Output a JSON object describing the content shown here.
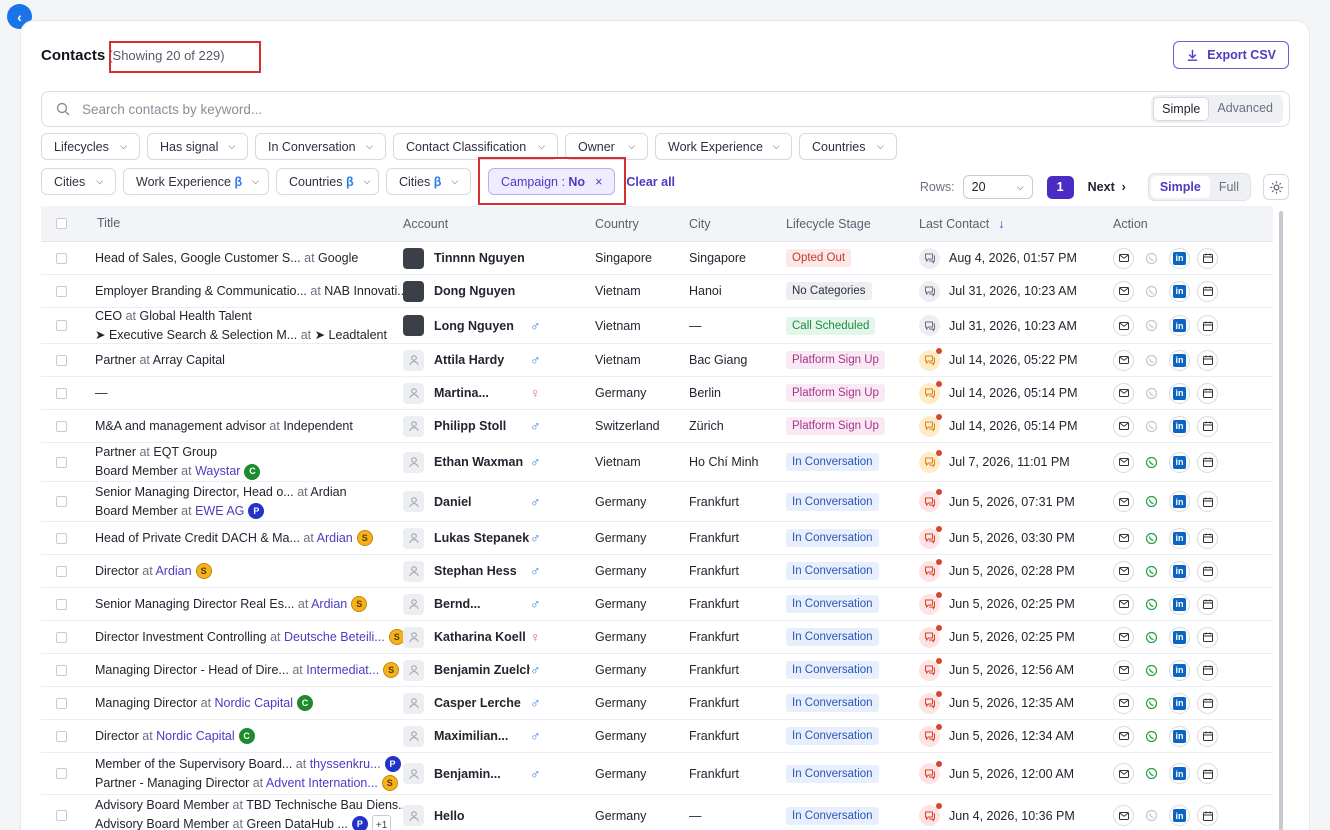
{
  "header": {
    "title": "Contacts",
    "count": "(Showing 20 of 229)",
    "export_label": "Export CSV"
  },
  "search": {
    "placeholder": "Search contacts by keyword...",
    "mode_simple": "Simple",
    "mode_advanced": "Advanced"
  },
  "filters_row1": [
    "Lifecycles",
    "Has signal",
    "In Conversation",
    "Contact Classification",
    "Owner",
    "Work Experience",
    "Countries"
  ],
  "filters_row2": [
    {
      "label": "Cities",
      "beta": ""
    },
    {
      "label": "Work Experience",
      "beta": "β"
    },
    {
      "label": "Countries",
      "beta": "β"
    },
    {
      "label": "Cities",
      "beta": "β"
    }
  ],
  "active_filter": {
    "prefix": "Campaign : ",
    "value": "No",
    "remove": "×"
  },
  "clear_all": "Clear all",
  "pagination": {
    "rows_label": "Rows:",
    "rows_value": "20",
    "page": "1",
    "next": "Next",
    "view_simple": "Simple",
    "view_full": "Full"
  },
  "columns": {
    "title": "Title",
    "account": "Account",
    "country": "Country",
    "city": "City",
    "lifecycle": "Lifecycle Stage",
    "last_contact": "Last Contact",
    "action": "Action"
  },
  "colors": {
    "accent": "#4a2bc4",
    "link": "#4b3cc2",
    "highlight_box": "#d62f2f"
  },
  "rows": [
    {
      "lines": [
        {
          "t": "Head of Sales, Google Customer S...",
          "at": "Google",
          "link": false,
          "tag": ""
        }
      ],
      "name": "Tinnnn Nguyen",
      "avatar": "photo",
      "gender": "",
      "country": "Singapore",
      "city": "Singapore",
      "stage": "Opted Out",
      "stage_kind": "out",
      "msg": "grey",
      "dot": false,
      "date": "Aug 4, 2026, 01:57 PM",
      "wa": false
    },
    {
      "lines": [
        {
          "t": "Employer Branding & Communicatio...",
          "at": "NAB Innovati...",
          "link": false,
          "tag": ""
        }
      ],
      "name": "Dong Nguyen",
      "avatar": "photo",
      "gender": "",
      "country": "Vietnam",
      "city": "Hanoi",
      "stage": "No Categories",
      "stage_kind": "nocat",
      "msg": "grey",
      "dot": false,
      "date": "Jul 31, 2026, 10:23 AM",
      "wa": false
    },
    {
      "lines": [
        {
          "t": "CEO",
          "at": "Global Health Talent",
          "link": false,
          "tag": ""
        },
        {
          "t": "➤ Executive Search & Selection M...",
          "at": "➤ Leadtalent",
          "link": false,
          "tag": ""
        }
      ],
      "name": "Long Nguyen",
      "avatar": "photo",
      "gender": "male",
      "country": "Vietnam",
      "city": "—",
      "stage": "Call Scheduled",
      "stage_kind": "call",
      "msg": "grey",
      "dot": false,
      "date": "Jul 31, 2026, 10:23 AM",
      "wa": false
    },
    {
      "lines": [
        {
          "t": "Partner",
          "at": "Array Capital",
          "link": false,
          "tag": ""
        }
      ],
      "name": "Attila Hardy",
      "avatar": "ph",
      "gender": "male",
      "country": "Vietnam",
      "city": "Bac Giang",
      "stage": "Platform Sign Up",
      "stage_kind": "sign",
      "msg": "orange",
      "dot": true,
      "date": "Jul 14, 2026, 05:22 PM",
      "wa": false
    },
    {
      "lines": [
        {
          "t": "—",
          "at": "",
          "link": false,
          "tag": ""
        }
      ],
      "name": "Martina...",
      "avatar": "ph",
      "gender": "female",
      "country": "Germany",
      "city": "Berlin",
      "stage": "Platform Sign Up",
      "stage_kind": "sign",
      "msg": "orange",
      "dot": true,
      "date": "Jul 14, 2026, 05:14 PM",
      "wa": false
    },
    {
      "lines": [
        {
          "t": "M&A and management advisor",
          "at": "Independent",
          "link": false,
          "tag": ""
        }
      ],
      "name": "Philipp Stoll",
      "avatar": "ph",
      "gender": "male",
      "country": "Switzerland",
      "city": "Zürich",
      "stage": "Platform Sign Up",
      "stage_kind": "sign",
      "msg": "orange",
      "dot": true,
      "date": "Jul 14, 2026, 05:14 PM",
      "wa": false
    },
    {
      "lines": [
        {
          "t": "Partner",
          "at": "EQT Group",
          "link": false,
          "tag": ""
        },
        {
          "t": "Board Member",
          "at": "Waystar",
          "link": true,
          "tag": "C"
        }
      ],
      "name": "Ethan Waxman",
      "avatar": "ph",
      "gender": "male",
      "country": "Vietnam",
      "city": "Ho Chí Minh",
      "stage": "In Conversation",
      "stage_kind": "conv",
      "msg": "orange",
      "dot": true,
      "date": "Jul 7, 2026, 11:01 PM",
      "wa": true
    },
    {
      "lines": [
        {
          "t": "Senior Managing Director, Head o...",
          "at": "Ardian",
          "link": false,
          "tag": ""
        },
        {
          "t": "Board Member",
          "at": "EWE AG",
          "link": true,
          "tag": "P"
        }
      ],
      "name": "Daniel",
      "avatar": "ph",
      "gender": "male",
      "country": "Germany",
      "city": "Frankfurt",
      "stage": "In Conversation",
      "stage_kind": "conv",
      "msg": "red",
      "dot": true,
      "date": "Jun 5, 2026, 07:31 PM",
      "wa": true
    },
    {
      "lines": [
        {
          "t": "Head of Private Credit DACH & Ma...",
          "at": "Ardian",
          "link": true,
          "tag": "S"
        }
      ],
      "name": "Lukas Stepanek",
      "avatar": "ph",
      "gender": "male",
      "country": "Germany",
      "city": "Frankfurt",
      "stage": "In Conversation",
      "stage_kind": "conv",
      "msg": "red",
      "dot": true,
      "date": "Jun 5, 2026, 03:30 PM",
      "wa": true
    },
    {
      "lines": [
        {
          "t": "Director",
          "at": "Ardian",
          "link": true,
          "tag": "S"
        }
      ],
      "name": "Stephan Hess",
      "avatar": "ph",
      "gender": "male",
      "country": "Germany",
      "city": "Frankfurt",
      "stage": "In Conversation",
      "stage_kind": "conv",
      "msg": "red",
      "dot": true,
      "date": "Jun 5, 2026, 02:28 PM",
      "wa": true
    },
    {
      "lines": [
        {
          "t": "Senior Managing Director Real Es...",
          "at": "Ardian",
          "link": true,
          "tag": "S"
        }
      ],
      "name": "Bernd...",
      "avatar": "ph",
      "gender": "male",
      "country": "Germany",
      "city": "Frankfurt",
      "stage": "In Conversation",
      "stage_kind": "conv",
      "msg": "red",
      "dot": true,
      "date": "Jun 5, 2026, 02:25 PM",
      "wa": true
    },
    {
      "lines": [
        {
          "t": "Director Investment Controlling",
          "at": "Deutsche Beteili...",
          "link": true,
          "tag": "S"
        }
      ],
      "name": "Katharina Koell",
      "avatar": "ph",
      "gender": "female",
      "country": "Germany",
      "city": "Frankfurt",
      "stage": "In Conversation",
      "stage_kind": "conv",
      "msg": "red",
      "dot": true,
      "date": "Jun 5, 2026, 02:25 PM",
      "wa": true
    },
    {
      "lines": [
        {
          "t": "Managing Director - Head of Dire...",
          "at": "Intermediat...",
          "link": true,
          "tag": "S"
        }
      ],
      "name": "Benjamin Zuelch",
      "avatar": "ph",
      "gender": "male",
      "country": "Germany",
      "city": "Frankfurt",
      "stage": "In Conversation",
      "stage_kind": "conv",
      "msg": "red",
      "dot": true,
      "date": "Jun 5, 2026, 12:56 AM",
      "wa": true
    },
    {
      "lines": [
        {
          "t": "Managing Director",
          "at": "Nordic Capital",
          "link": true,
          "tag": "C"
        }
      ],
      "name": "Casper Lerche",
      "avatar": "ph",
      "gender": "male",
      "country": "Germany",
      "city": "Frankfurt",
      "stage": "In Conversation",
      "stage_kind": "conv",
      "msg": "red",
      "dot": true,
      "date": "Jun 5, 2026, 12:35 AM",
      "wa": true
    },
    {
      "lines": [
        {
          "t": "Director",
          "at": "Nordic Capital",
          "link": true,
          "tag": "C"
        }
      ],
      "name": "Maximilian...",
      "avatar": "ph",
      "gender": "male",
      "country": "Germany",
      "city": "Frankfurt",
      "stage": "In Conversation",
      "stage_kind": "conv",
      "msg": "red",
      "dot": true,
      "date": "Jun 5, 2026, 12:34 AM",
      "wa": true
    },
    {
      "lines": [
        {
          "t": "Member of the Supervisory Board...",
          "at": "thyssenkru...",
          "link": true,
          "tag": "P"
        },
        {
          "t": "Partner - Managing Director",
          "at": "Advent Internation...",
          "link": true,
          "tag": "S"
        }
      ],
      "name": "Benjamin...",
      "avatar": "ph",
      "gender": "male",
      "country": "Germany",
      "city": "Frankfurt",
      "stage": "In Conversation",
      "stage_kind": "conv",
      "msg": "red",
      "dot": true,
      "date": "Jun 5, 2026, 12:00 AM",
      "wa": true
    },
    {
      "lines": [
        {
          "t": "Advisory Board Member",
          "at": "TBD Technische Bau Diens...",
          "link": false,
          "tag": ""
        },
        {
          "t": "Advisory Board Member",
          "at": "Green DataHub ...",
          "link": false,
          "tag": "P",
          "plus": "+1"
        }
      ],
      "name": "Hello",
      "avatar": "ph",
      "gender": "",
      "country": "Germany",
      "city": "—",
      "stage": "In Conversation",
      "stage_kind": "conv",
      "msg": "red",
      "dot": true,
      "date": "Jun 4, 2026, 10:36 PM",
      "wa": false
    }
  ]
}
